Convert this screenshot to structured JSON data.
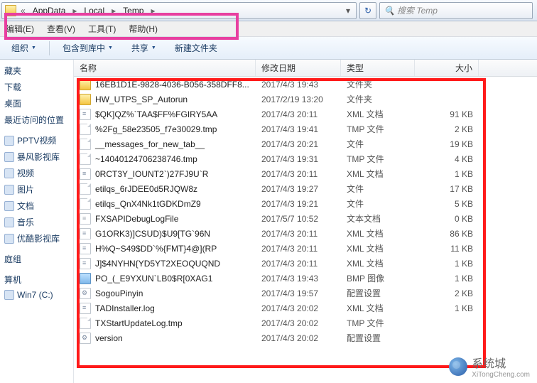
{
  "breadcrumbs": {
    "b1": "AppData",
    "b2": "Local",
    "b3": "Temp"
  },
  "search": {
    "placeholder": "搜索 Temp"
  },
  "menu": {
    "m1": "编辑(E)",
    "m2": "查看(V)",
    "m3": "工具(T)",
    "m4": "帮助(H)"
  },
  "toolbar": {
    "organize": "组织",
    "include": "包含到库中",
    "share": "共享",
    "newfolder": "新建文件夹"
  },
  "sidebar": {
    "s0": "藏夹",
    "s1": "下载",
    "s2": "桌面",
    "s3": "最近访问的位置",
    "s4": "PPTV视频",
    "s5": "暴风影视库",
    "s6": "视频",
    "s7": "图片",
    "s8": "文档",
    "s9": "音乐",
    "s10": "优酷影视库",
    "s11": "庭组",
    "s12": "算机",
    "s13": "Win7 (C:)"
  },
  "columns": {
    "name": "名称",
    "date": "修改日期",
    "type": "类型",
    "size": "大小"
  },
  "files": [
    {
      "name": "16EB1D1E-9828-4036-B056-358DFF8...",
      "date": "2017/4/3 19:43",
      "type": "文件夹",
      "size": "",
      "icon": "ico-folder"
    },
    {
      "name": "HW_UTPS_SP_Autorun",
      "date": "2017/2/19 13:20",
      "type": "文件夹",
      "size": "",
      "icon": "ico-folder"
    },
    {
      "name": "$QK]QZ%`TAA$FF%FGIRY5AA",
      "date": "2017/4/3 20:11",
      "type": "XML 文档",
      "size": "91 KB",
      "icon": "ico-xml"
    },
    {
      "name": "%2Fg_58e23505_f7e30029.tmp",
      "date": "2017/4/3 19:41",
      "type": "TMP 文件",
      "size": "2 KB",
      "icon": "ico-file"
    },
    {
      "name": "__messages_for_new_tab__",
      "date": "2017/4/3 20:21",
      "type": "文件",
      "size": "19 KB",
      "icon": "ico-file"
    },
    {
      "name": "~14040124706238746.tmp",
      "date": "2017/4/3 19:31",
      "type": "TMP 文件",
      "size": "4 KB",
      "icon": "ico-file"
    },
    {
      "name": "0RCT3Y_IOUNT2`)27FJ9U`R",
      "date": "2017/4/3 20:11",
      "type": "XML 文档",
      "size": "1 KB",
      "icon": "ico-xml"
    },
    {
      "name": "etilqs_6rJDEE0d5RJQW8z",
      "date": "2017/4/3 19:27",
      "type": "文件",
      "size": "17 KB",
      "icon": "ico-file"
    },
    {
      "name": "etilqs_QnX4Nk1tGDKDmZ9",
      "date": "2017/4/3 19:21",
      "type": "文件",
      "size": "5 KB",
      "icon": "ico-file"
    },
    {
      "name": "FXSAPIDebugLogFile",
      "date": "2017/5/7 10:52",
      "type": "文本文档",
      "size": "0 KB",
      "icon": "ico-txt"
    },
    {
      "name": "G1ORK3)]CSUD)$U9[TG`96N",
      "date": "2017/4/3 20:11",
      "type": "XML 文档",
      "size": "86 KB",
      "icon": "ico-xml"
    },
    {
      "name": "H%Q~S49$DD`%{FMT}4@](RP",
      "date": "2017/4/3 20:11",
      "type": "XML 文档",
      "size": "11 KB",
      "icon": "ico-xml"
    },
    {
      "name": "J]$4NYHN{YD5YT2XEOQUQND",
      "date": "2017/4/3 20:11",
      "type": "XML 文档",
      "size": "1 KB",
      "icon": "ico-xml"
    },
    {
      "name": "PO_(_E9YXUN`LB0$R[0XAG1",
      "date": "2017/4/3 19:43",
      "type": "BMP 图像",
      "size": "1 KB",
      "icon": "ico-bmp"
    },
    {
      "name": "SogouPinyin",
      "date": "2017/4/3 19:57",
      "type": "配置设置",
      "size": "2 KB",
      "icon": "ico-cfg"
    },
    {
      "name": "TADInstaller.log",
      "date": "2017/4/3 20:02",
      "type": "XML 文档",
      "size": "1 KB",
      "icon": "ico-xml"
    },
    {
      "name": "TXStartUpdateLog.tmp",
      "date": "2017/4/3 20:02",
      "type": "TMP 文件",
      "size": "",
      "icon": "ico-file"
    },
    {
      "name": "version",
      "date": "2017/4/3 20:02",
      "type": "配置设置",
      "size": "",
      "icon": "ico-cfg"
    }
  ],
  "watermark": {
    "text": "系统城",
    "url": "XiTongCheng.com"
  }
}
